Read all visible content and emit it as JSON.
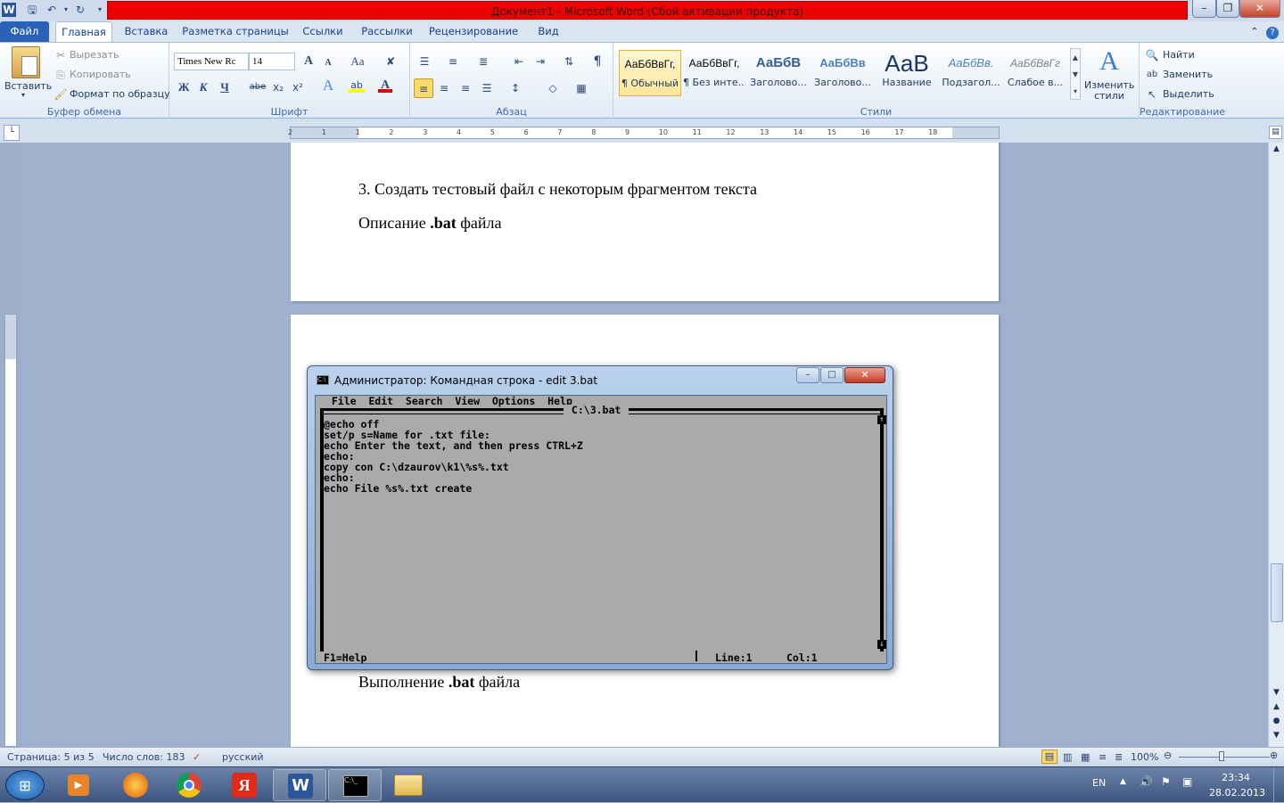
{
  "window": {
    "title": "Документ1  -  Microsoft Word (Сбой активации продукта)",
    "app_icon": "W"
  },
  "quick_access": {
    "save_icon": "save-icon",
    "undo_icon": "undo-icon",
    "redo_icon": "redo-icon"
  },
  "tabs": [
    "Файл",
    "Главная",
    "Вставка",
    "Разметка страницы",
    "Ссылки",
    "Рассылки",
    "Рецензирование",
    "Вид"
  ],
  "clipboard": {
    "paste": "Вставить",
    "cut": "Вырезать",
    "copy": "Копировать",
    "format_painter": "Формат по образцу",
    "label": "Буфер обмена"
  },
  "font": {
    "name": "Times New Rc",
    "size": "14",
    "grow": "A",
    "shrink": "A",
    "case": "Aa",
    "bold": "Ж",
    "italic": "К",
    "underline": "Ч",
    "strike": "abe",
    "sub": "x₂",
    "sup": "x²",
    "label": "Шрифт"
  },
  "paragraph": {
    "label": "Абзац",
    "pilcrow": "¶"
  },
  "styles": {
    "items": [
      {
        "preview": "АаБбВвГг,",
        "name": "¶ Обычный"
      },
      {
        "preview": "АаБбВвГг,",
        "name": "¶ Без инте..."
      },
      {
        "preview": "АаБбВ",
        "name": "Заголово..."
      },
      {
        "preview": "АаБбВв",
        "name": "Заголово..."
      },
      {
        "preview": "АаВ",
        "name": "Название"
      },
      {
        "preview": "АаБбВв.",
        "name": "Подзагол..."
      },
      {
        "preview": "АаБбВвГг",
        "name": "Слабое в..."
      }
    ],
    "change": "Изменить стили",
    "label": "Стили"
  },
  "editing": {
    "find": "Найти",
    "replace": "Заменить",
    "select": "Выделить",
    "label": "Редактирование"
  },
  "ruler": {
    "ticks": [
      "2",
      "1",
      "1",
      "2",
      "3",
      "4",
      "5",
      "6",
      "7",
      "8",
      "9",
      "10",
      "11",
      "12",
      "13",
      "14",
      "15",
      "16",
      "17",
      "18"
    ]
  },
  "document": {
    "line1": "3. Создать тестовый файл с некоторым фрагментом текста",
    "line2_pre": "Описание ",
    "line2_bold": ".bat",
    "line2_post": " файла",
    "line3_pre": "Выполнение ",
    "line3_bold": ".bat",
    "line3_post": " файла"
  },
  "cmd": {
    "title": "Администратор: Командная строка - edit  3.bat",
    "menu": "  File  Edit  Search  View  Options  Help",
    "filename": " C:\\3.bat ",
    "lines": [
      "@echo off",
      "set/p s=Name for .txt file:",
      "echo Enter the text, and then press CTRL+Z",
      "echo:",
      "copy con C:\\dzaurov\\k1\\%s%.txt",
      "echo:",
      "echo File %s%.txt create"
    ],
    "status_help": "F1=Help",
    "status_line": "Line:1",
    "status_col": "Col:1"
  },
  "statusbar": {
    "page": "Страница: 5 из 5",
    "words": "Число слов: 183",
    "lang": "русский",
    "zoom": "100%"
  },
  "taskbar": {
    "lang": "EN",
    "time": "23:34",
    "date": "28.02.2013"
  }
}
